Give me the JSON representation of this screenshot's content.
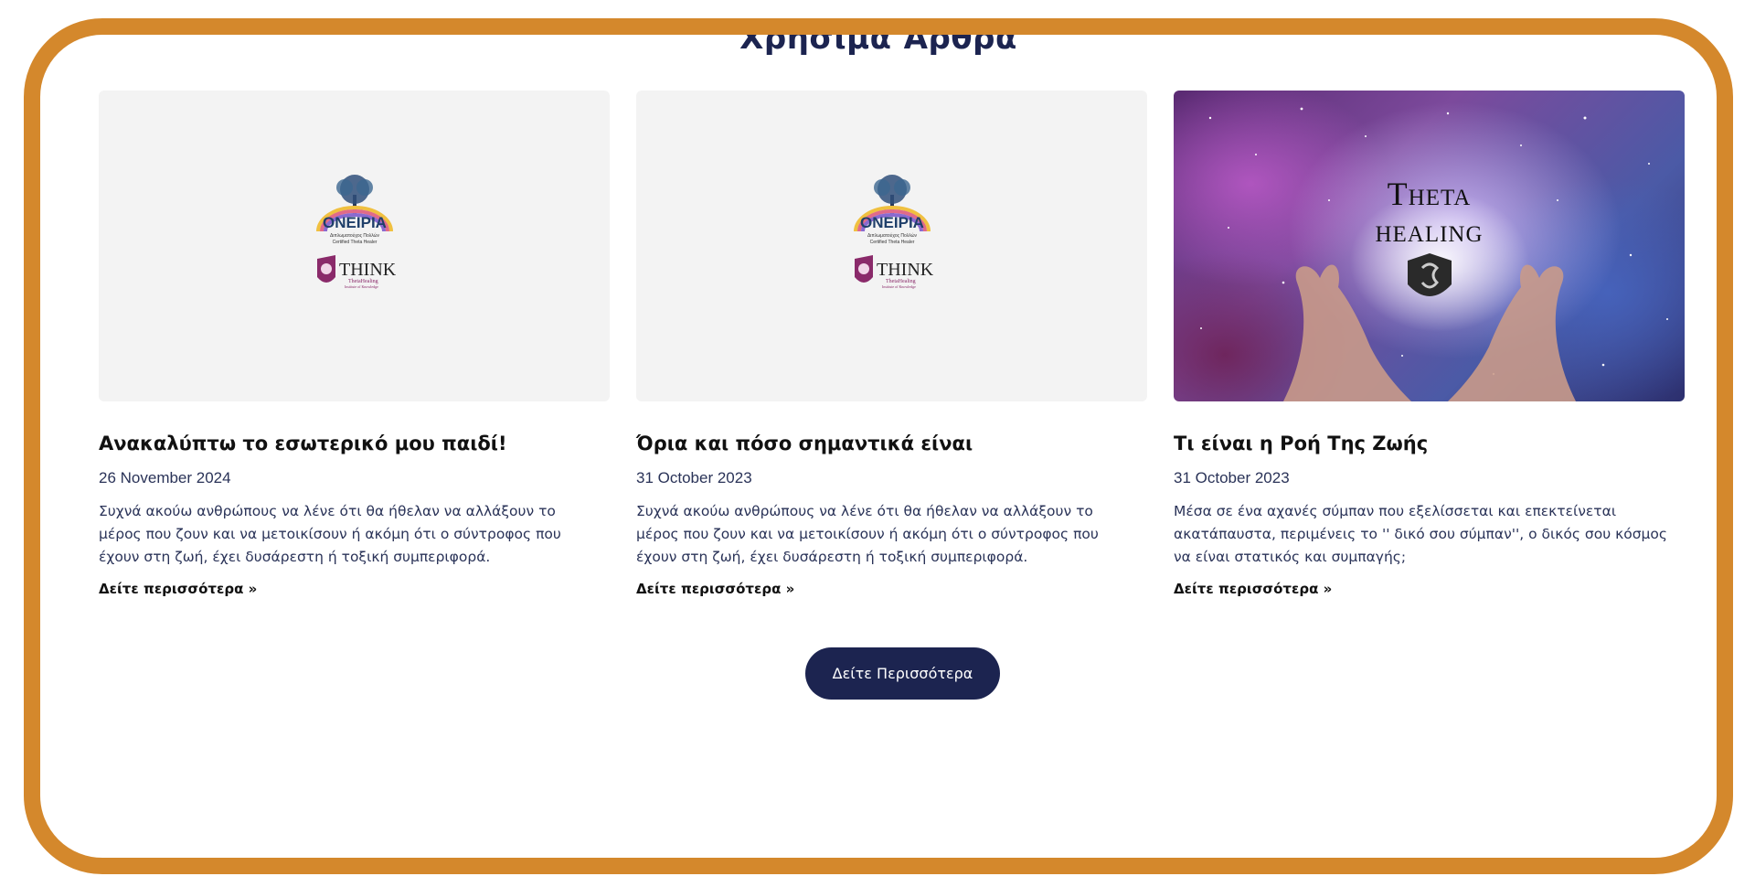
{
  "section": {
    "title": "Χρήσιμα Άρθρα"
  },
  "cards": [
    {
      "title": "Ανακαλύπτω το εσωτερικό μου παιδί!",
      "date": "26 November 2024",
      "excerpt": "Συχνά ακούω ανθρώπους να λένε ότι θα ήθελαν να αλλάξουν το μέρος που ζουν και να μετοικίσουν ή ακόμη ότι ο σύντροφος που έχουν στη ζωή, έχει δυσάρεστη ή τοξική συμπεριφορά.",
      "more": "Δείτε περισσότερα »",
      "image": "oneiria-logo"
    },
    {
      "title": "Όρια  και  πόσο  σημαντικά είναι",
      "date": "31 October 2023",
      "excerpt": "Συχνά ακούω ανθρώπους να λένε ότι θα ήθελαν να αλλάξουν το μέρος που ζουν και να μετοικίσουν ή ακόμη ότι ο σύντροφος που έχουν στη ζωή, έχει δυσάρεστη ή τοξική συμπεριφορά.",
      "more": "Δείτε περισσότερα »",
      "image": "oneiria-logo"
    },
    {
      "title": "Τι είναι η Ροή Της Ζωής",
      "date": "31 October 2023",
      "excerpt": "Μέσα σε ένα αχανές σύμπαν που εξελίσσεται και επεκτείνεται ακατάπαυστα, περιμένεις το '' δικό σου σύμπαν'', ο δικός σου κόσμος να είναι στατικός και συμπαγής;",
      "more": "Δείτε περισσότερα »",
      "image": "theta-healing-cosmos",
      "image_title_line1": "Theta",
      "image_title_line2": "healing"
    }
  ],
  "logo": {
    "brand": "ONEIPIA",
    "subtitle1": "Διπλωματούχος Πολλών",
    "subtitle2": "Certified Theta Healer",
    "think": "THINK",
    "thetahealing": "ThetaHealing",
    "institute": "Institute of Knowledge"
  },
  "more_button": {
    "label": "Δείτε Περισσότερα"
  },
  "colors": {
    "frame": "#d4882c",
    "navy": "#1c2450",
    "placeholder_bg": "#f3f3f3"
  }
}
